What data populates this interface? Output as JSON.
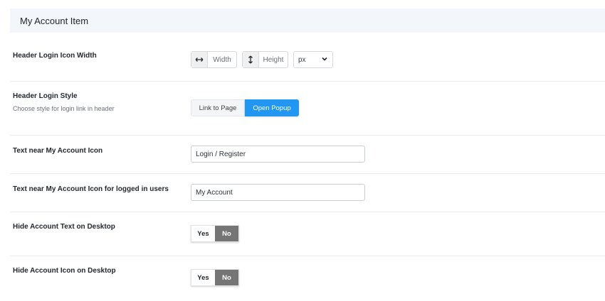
{
  "section": {
    "title": "My Account Item"
  },
  "rows": {
    "icon_width": {
      "label": "Header Login Icon Width",
      "width_placeholder": "Width",
      "height_placeholder": "Height",
      "unit_value": "px",
      "width_icon": "horizontal-arrows-icon",
      "height_icon": "vertical-arrows-icon"
    },
    "login_style": {
      "label": "Header Login Style",
      "description": "Choose style for login link in header",
      "options": [
        "Link to Page",
        "Open Popup"
      ],
      "selected": "Open Popup"
    },
    "account_text": {
      "label": "Text near My Account Icon",
      "value": "Login / Register"
    },
    "account_text_logged": {
      "label": "Text near My Account Icon for logged in users",
      "value": "My Account"
    },
    "hide_text": {
      "label": "Hide Account Text on Desktop",
      "yes": "Yes",
      "no": "No",
      "selected": "No"
    },
    "hide_icon": {
      "label": "Hide Account Icon on Desktop",
      "yes": "Yes",
      "no": "No",
      "selected": "No"
    }
  },
  "colors": {
    "accent": "#2196f3",
    "toggle_active": "#757575",
    "header_bg": "#f3f6fa"
  }
}
